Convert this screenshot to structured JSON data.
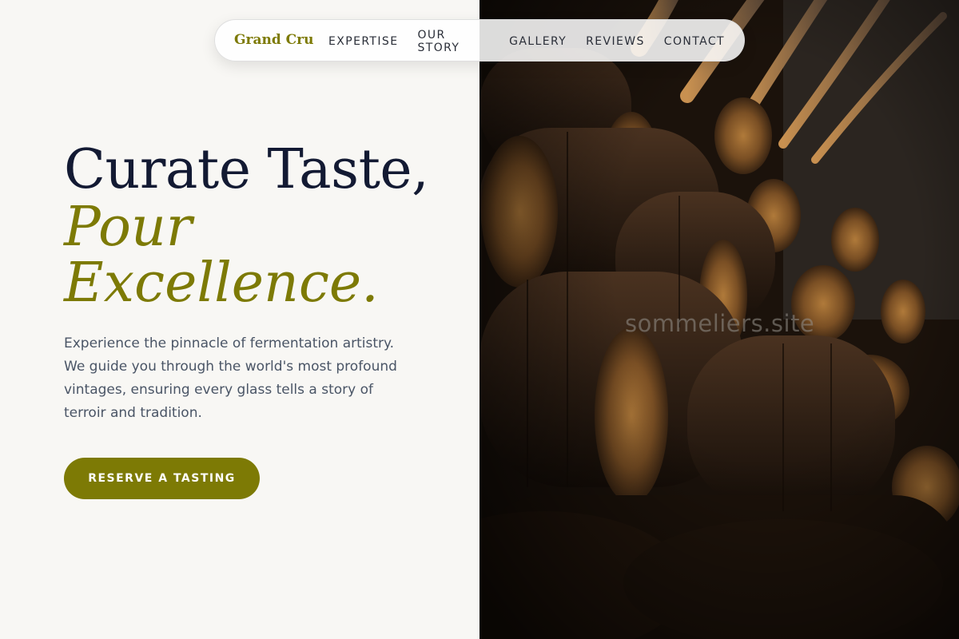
{
  "nav": {
    "brand": "Grand Cru",
    "links": [
      "EXPERTISE",
      "OUR STORY",
      "GALLERY",
      "REVIEWS",
      "CONTACT"
    ]
  },
  "hero": {
    "headline": "Curate Taste,",
    "headline_accent": "Pour Excellence.",
    "lead": "Experience the pinnacle of fermentation artistry. We guide you through the world's most profound vintages, ensuring every glass tells a story of terroir and tradition.",
    "cta_label": "RESERVE A TASTING"
  },
  "image": {
    "subject": "wine-barrels-in-cellar",
    "watermark": "sommeliers.site"
  },
  "colors": {
    "background": "#f8f7f4",
    "accent": "#7d7a05",
    "heading": "#131a33",
    "body_text": "#4a5566"
  }
}
